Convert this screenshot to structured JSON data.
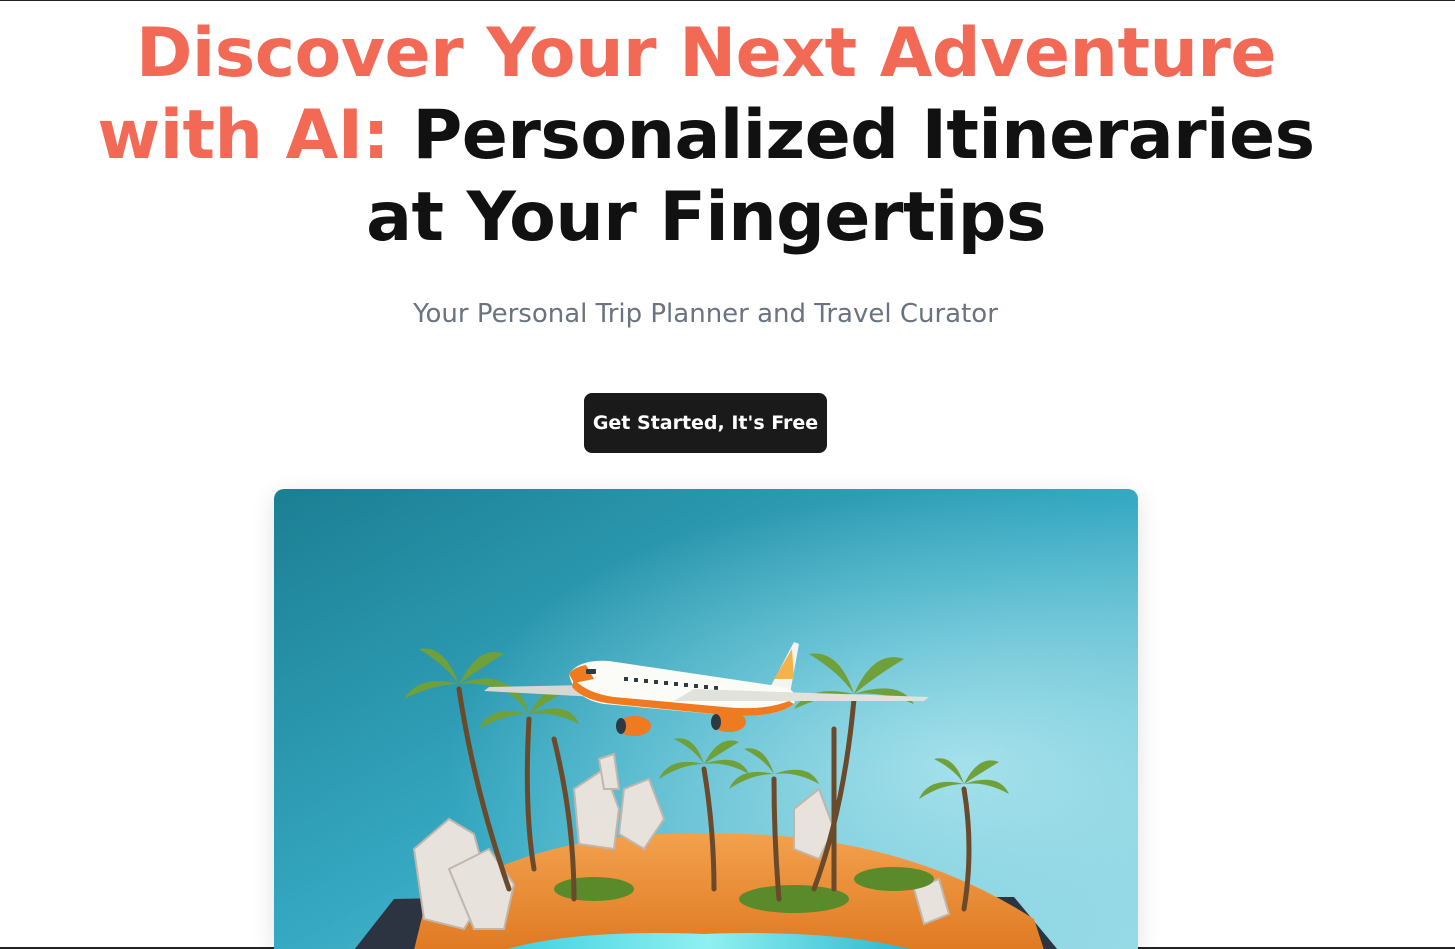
{
  "hero": {
    "headline_accent": "Discover Your Next Adventure with AI:",
    "headline_main": "Personalized Itineraries at Your Fingertips",
    "subtitle": "Your Personal Trip Planner and Travel Curator",
    "cta_label": "Get Started, It's Free"
  },
  "colors": {
    "accent": "#f26a56",
    "heading": "#111111",
    "subtitle": "#6b7280",
    "button_bg": "#1a1a1a",
    "button_text": "#ffffff"
  },
  "image": {
    "subject": "airplane-over-tropical-island-illustration"
  }
}
